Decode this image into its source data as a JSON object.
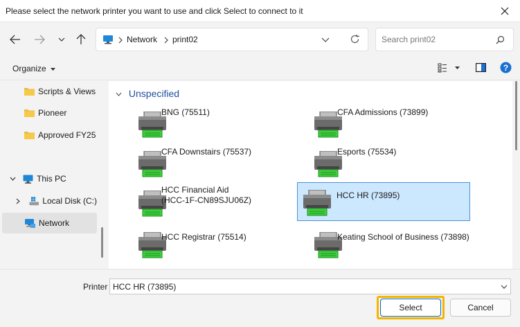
{
  "window": {
    "title": "Please select the network printer you want to use and click Select to connect to it"
  },
  "address": {
    "crumbs": [
      "Network",
      "print02"
    ]
  },
  "search": {
    "placeholder": "Search print02"
  },
  "toolbar": {
    "organize_label": "Organize"
  },
  "sidebar": {
    "items": [
      {
        "label": "Scripts & Views",
        "icon": "folder-icon"
      },
      {
        "label": "Pioneer",
        "icon": "folder-icon"
      },
      {
        "label": "Approved FY25",
        "icon": "folder-icon"
      },
      {
        "label": "This PC",
        "icon": "computer-icon"
      },
      {
        "label": "Local Disk (C:)",
        "icon": "drive-icon"
      },
      {
        "label": "Network",
        "icon": "network-icon",
        "selected": true
      }
    ]
  },
  "group": {
    "header": "Unspecified"
  },
  "printers": [
    {
      "line1": "BNG (75511)",
      "line2": ""
    },
    {
      "line1": "CFA Admissions (73899)",
      "line2": ""
    },
    {
      "line1": "CFA Downstairs (75537)",
      "line2": ""
    },
    {
      "line1": "Esports (75534)",
      "line2": ""
    },
    {
      "line1": "HCC Financial Aid",
      "line2": "(HCC-1F-CN89SJU06Z)"
    },
    {
      "line1": "HCC HR (73895)",
      "line2": "",
      "selected": true
    },
    {
      "line1": "HCC Registrar (75514)",
      "line2": ""
    },
    {
      "line1": "Keating School of Business (73898)",
      "line2": ""
    }
  ],
  "footer": {
    "printer_label": "Printer",
    "printer_value": "HCC HR (73895)",
    "select_label": "Select",
    "cancel_label": "Cancel"
  },
  "colors": {
    "accent": "#0067c0",
    "selection_bg": "#cce8ff",
    "highlight": "#f4b400",
    "group_header": "#1f4e9e"
  }
}
